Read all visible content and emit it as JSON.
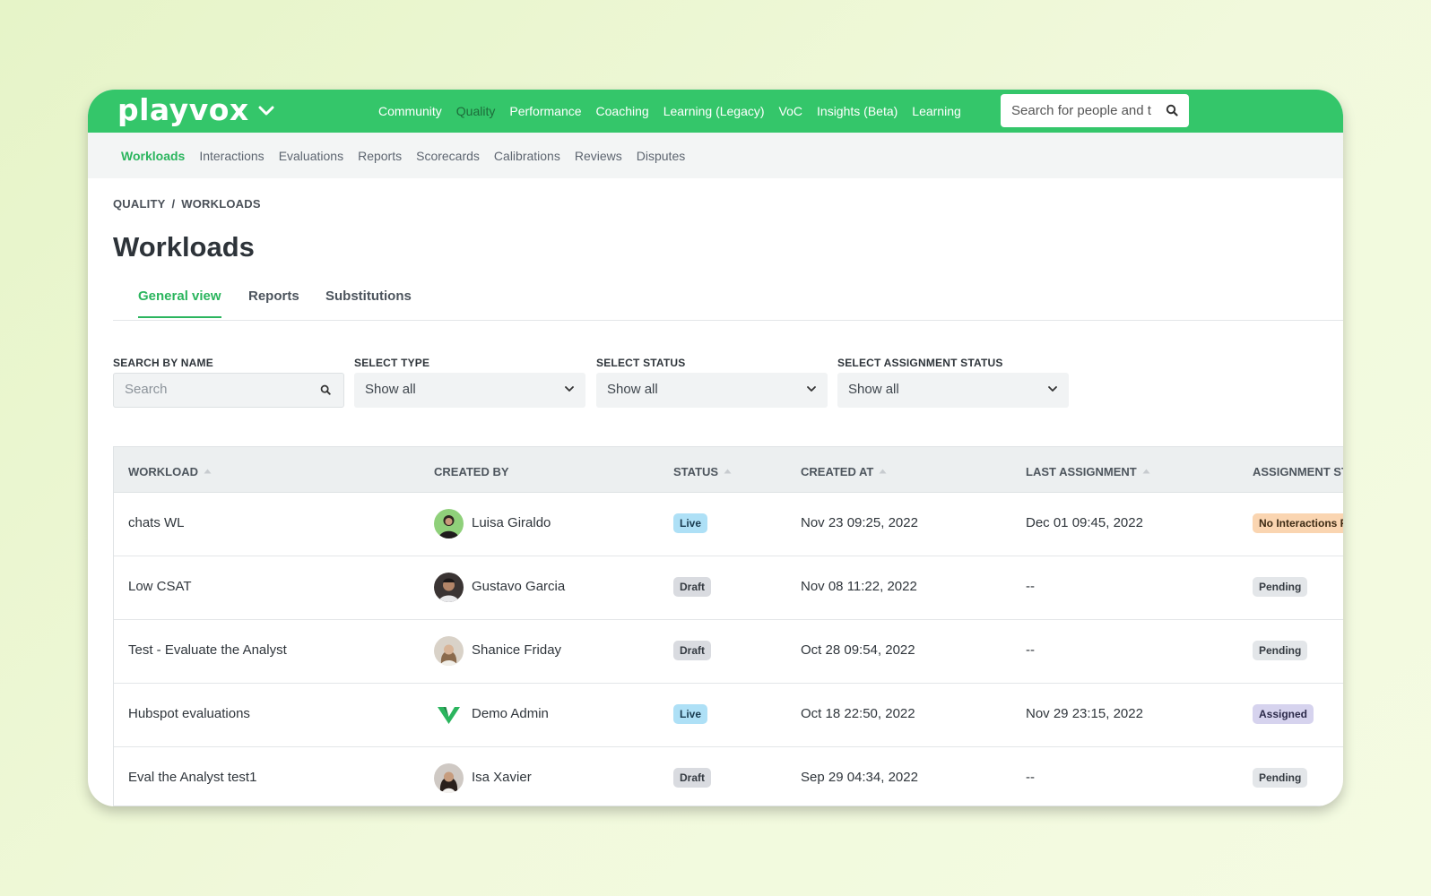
{
  "app": {
    "brand": "playvox",
    "colors": {
      "primary": "#34c66a",
      "accent": "#2bb55e",
      "live": "#aee0f6",
      "draft": "#d9dbe0",
      "no_interactions": "#fad5b1",
      "assigned": "#d6d3ee"
    }
  },
  "topnav": {
    "items": [
      "Community",
      "Quality",
      "Performance",
      "Coaching",
      "Learning (Legacy)",
      "VoC",
      "Insights (Beta)",
      "Learning"
    ],
    "active": "Quality",
    "search_placeholder": "Search for people and t"
  },
  "subnav": {
    "items": [
      "Workloads",
      "Interactions",
      "Evaluations",
      "Reports",
      "Scorecards",
      "Calibrations",
      "Reviews",
      "Disputes"
    ],
    "active": "Workloads"
  },
  "breadcrumb": {
    "parent": "QUALITY",
    "separator": "/",
    "current": "WORKLOADS"
  },
  "page": {
    "title": "Workloads"
  },
  "tabs": [
    "General view",
    "Reports",
    "Substitutions"
  ],
  "filters": {
    "search": {
      "label": "SEARCH BY NAME",
      "placeholder": "Search"
    },
    "type": {
      "label": "SELECT TYPE",
      "value": "Show all"
    },
    "status": {
      "label": "SELECT STATUS",
      "value": "Show all"
    },
    "assignment": {
      "label": "SELECT ASSIGNMENT STATUS",
      "value": "Show all"
    }
  },
  "table": {
    "columns": [
      "WORKLOAD",
      "CREATED BY",
      "STATUS",
      "CREATED AT",
      "LAST ASSIGNMENT",
      "ASSIGNMENT ST"
    ],
    "rows": [
      {
        "workload": "chats WL",
        "created_by": "Luisa Giraldo",
        "status": "Live",
        "created_at": "Nov 23 09:25, 2022",
        "last_assignment": "Dec 01 09:45, 2022",
        "assignment_status": "No Interactions F"
      },
      {
        "workload": "Low CSAT",
        "created_by": "Gustavo Garcia",
        "status": "Draft",
        "created_at": "Nov 08 11:22, 2022",
        "last_assignment": "--",
        "assignment_status": "Pending"
      },
      {
        "workload": "Test - Evaluate the Analyst",
        "created_by": "Shanice Friday",
        "status": "Draft",
        "created_at": "Oct 28 09:54, 2022",
        "last_assignment": "--",
        "assignment_status": "Pending"
      },
      {
        "workload": "Hubspot evaluations",
        "created_by": "Demo Admin",
        "status": "Live",
        "created_at": "Oct 18 22:50, 2022",
        "last_assignment": "Nov 29 23:15, 2022",
        "assignment_status": "Assigned"
      },
      {
        "workload": "Eval the Analyst test1",
        "created_by": "Isa Xavier",
        "status": "Draft",
        "created_at": "Sep 29 04:34, 2022",
        "last_assignment": "--",
        "assignment_status": "Pending"
      }
    ]
  }
}
